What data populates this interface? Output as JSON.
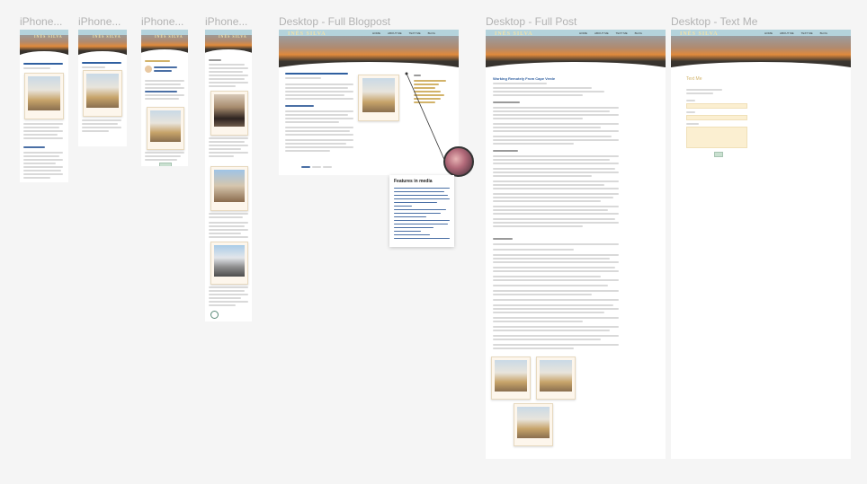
{
  "frames": {
    "iphone1": {
      "label": "iPhone..."
    },
    "iphone2": {
      "label": "iPhone..."
    },
    "iphone3": {
      "label": "iPhone..."
    },
    "iphone4": {
      "label": "iPhone..."
    },
    "desktop_blogpost": {
      "label": "Desktop - Full Blogpost"
    },
    "desktop_post": {
      "label": "Desktop - Full Post"
    },
    "desktop_textme": {
      "label": "Desktop - Text Me"
    }
  },
  "site": {
    "brand": "INÊS SILVA",
    "nav": [
      "HOME",
      "ABOUT ME",
      "TEXT ME",
      "BLOG"
    ]
  },
  "blogpost": {
    "title": "Working Remotely From Cape Verde"
  },
  "popup": {
    "title": "Features in media"
  },
  "textme": {
    "title": "Text Me"
  },
  "colors": {
    "canvas": "#f5f5f5",
    "topbar": "#b4d3dc",
    "accent_blue": "#2f5fa0",
    "field": "#fbefd1",
    "gold": "#d2b36a"
  }
}
